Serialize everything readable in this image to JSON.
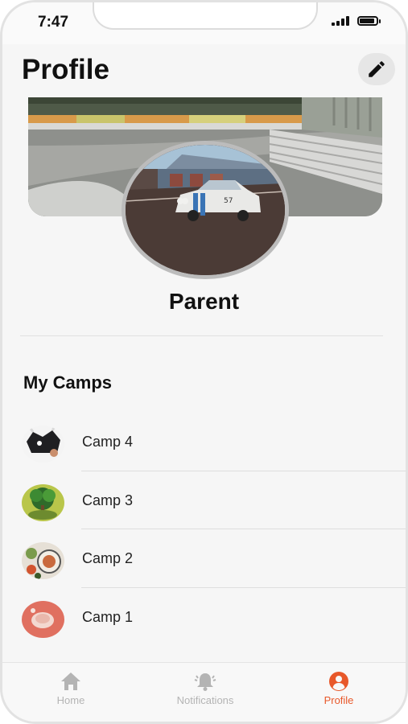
{
  "status_bar": {
    "time": "7:47"
  },
  "header": {
    "title": "Profile",
    "edit_icon": "pencil-icon"
  },
  "profile": {
    "name": "Parent"
  },
  "camps": {
    "title": "My Camps",
    "items": [
      {
        "label": "Camp 4"
      },
      {
        "label": "Camp 3"
      },
      {
        "label": "Camp 2"
      },
      {
        "label": "Camp 1"
      }
    ]
  },
  "tabs": [
    {
      "label": "Home",
      "icon": "home-icon",
      "active": false
    },
    {
      "label": "Notifications",
      "icon": "bell-icon",
      "active": false
    },
    {
      "label": "Profile",
      "icon": "user-circle-icon",
      "active": true
    }
  ],
  "colors": {
    "accent": "#e8582a",
    "inactive": "#b4b4b4",
    "background": "#f6f6f6"
  }
}
